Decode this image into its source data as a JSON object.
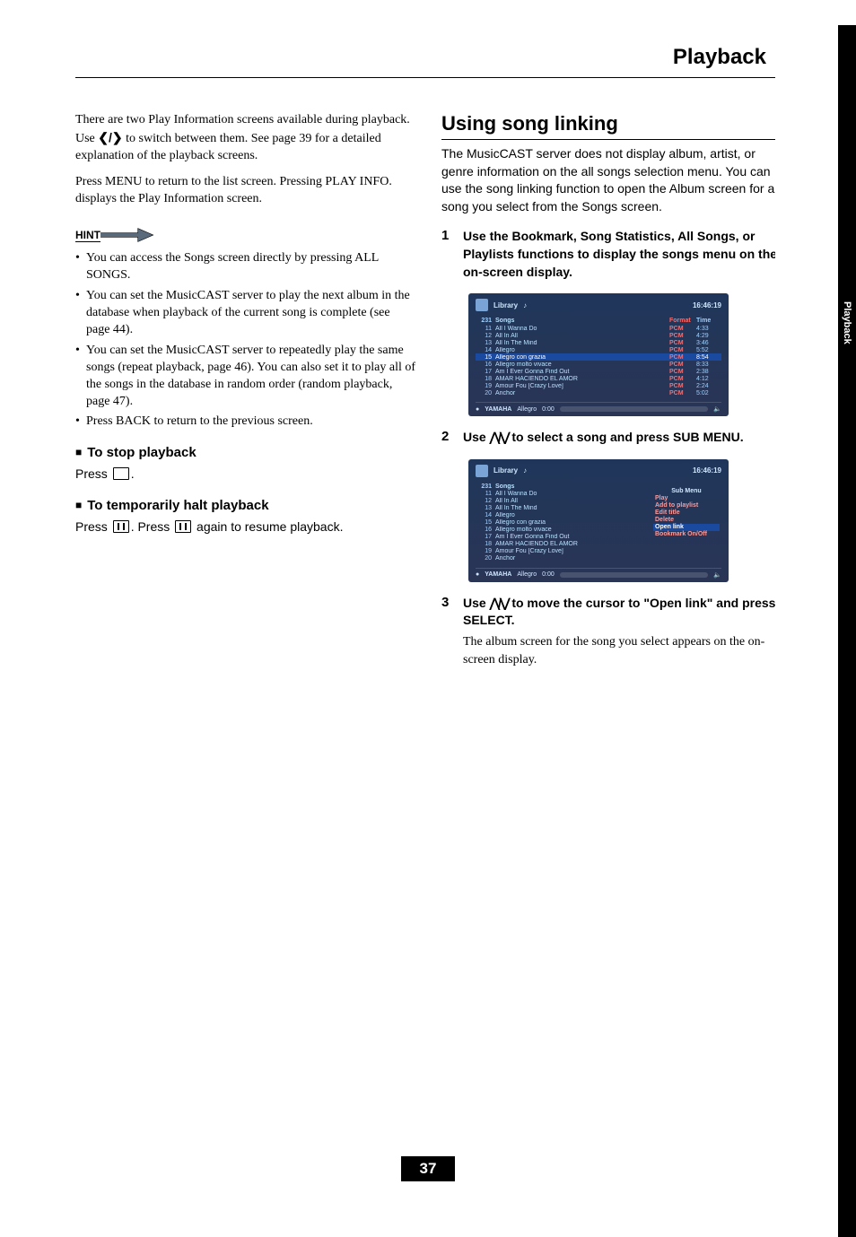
{
  "header": {
    "chapter": "Playback",
    "tab_label": "Playback",
    "page_number": "37"
  },
  "left": {
    "intro1": "There are two Play Information screens available during playback. Use ",
    "intro1b": " to switch between them. See page 39 for a detailed explanation of the playback screens.",
    "intro2": "Press MENU to return to the list screen. Pressing PLAY INFO. displays the Play Information screen.",
    "hint_label": "HINT",
    "hints": [
      "You can access the Songs screen directly by pressing ALL SONGS.",
      "You can set the MusicCAST server to play the next album in the database when playback of the current song is complete (see page 44).",
      "You can set the MusicCAST server to repeatedly play the same songs (repeat playback, page 46). You can also set it to play all of the songs in the database in random order (random playback, page 47).",
      "Press BACK to return to the previous screen."
    ],
    "sub1": "To stop playback",
    "sub1_text_a": "Press ",
    "sub1_text_b": ".",
    "sub2": "To temporarily halt playback",
    "sub2_text_a": "Press ",
    "sub2_text_b": ". Press ",
    "sub2_text_c": " again to resume playback."
  },
  "right": {
    "section_title": "Using song linking",
    "intro": "The MusicCAST server does not display album, artist, or genre information on the all songs selection menu. You can use the song linking function to open the Album screen for a song you select from the Songs screen.",
    "steps": [
      {
        "num": "1",
        "title": "Use the Bookmark, Song Statistics, All Songs, or Playlists functions to display the songs menu on the on-screen display."
      },
      {
        "num": "2",
        "title_a": "Use ",
        "title_b": " to select a song and press SUB MENU."
      },
      {
        "num": "3",
        "title_a": "Use ",
        "title_b": " to move the cursor to \"Open link\" and press SELECT.",
        "sub": "The album screen for the song you select appears on the on-screen display."
      }
    ],
    "osd_common": {
      "breadcrumb": "Library",
      "time": "16:46:19",
      "count": "231",
      "head_songs": "Songs",
      "head_format": "Format",
      "head_time": "Time",
      "footer_brand": "YAMAHA",
      "footer_track": "Allegro",
      "footer_time": "0:00"
    },
    "osd1_selected_index": 4,
    "songs": [
      {
        "n": "11",
        "t": "All I Wanna Do",
        "f": "PCM",
        "d": "4:33"
      },
      {
        "n": "12",
        "t": "All In All",
        "f": "PCM",
        "d": "4:29"
      },
      {
        "n": "13",
        "t": "All In The Mind",
        "f": "PCM",
        "d": "3:46"
      },
      {
        "n": "14",
        "t": "Allegro",
        "f": "PCM",
        "d": "5:52"
      },
      {
        "n": "15",
        "t": "Allegro con grazia",
        "f": "PCM",
        "d": "8:54"
      },
      {
        "n": "16",
        "t": "Allegro molto vivace",
        "f": "PCM",
        "d": "8:33"
      },
      {
        "n": "17",
        "t": "Am I Ever Gonna Find Out",
        "f": "PCM",
        "d": "2:38"
      },
      {
        "n": "18",
        "t": "AMAR HACIENDO EL AMOR",
        "f": "PCM",
        "d": "4:12"
      },
      {
        "n": "19",
        "t": "Amour Fou [Crazy Love]",
        "f": "PCM",
        "d": "2:24"
      },
      {
        "n": "20",
        "t": "Anchor",
        "f": "PCM",
        "d": "5:02"
      }
    ],
    "submenu": {
      "head": "Sub Menu",
      "items": [
        "Play",
        "Add to playlist",
        "Edit title",
        "Delete",
        "Open link",
        "Bookmark On/Off"
      ],
      "selected_index": 4
    }
  }
}
